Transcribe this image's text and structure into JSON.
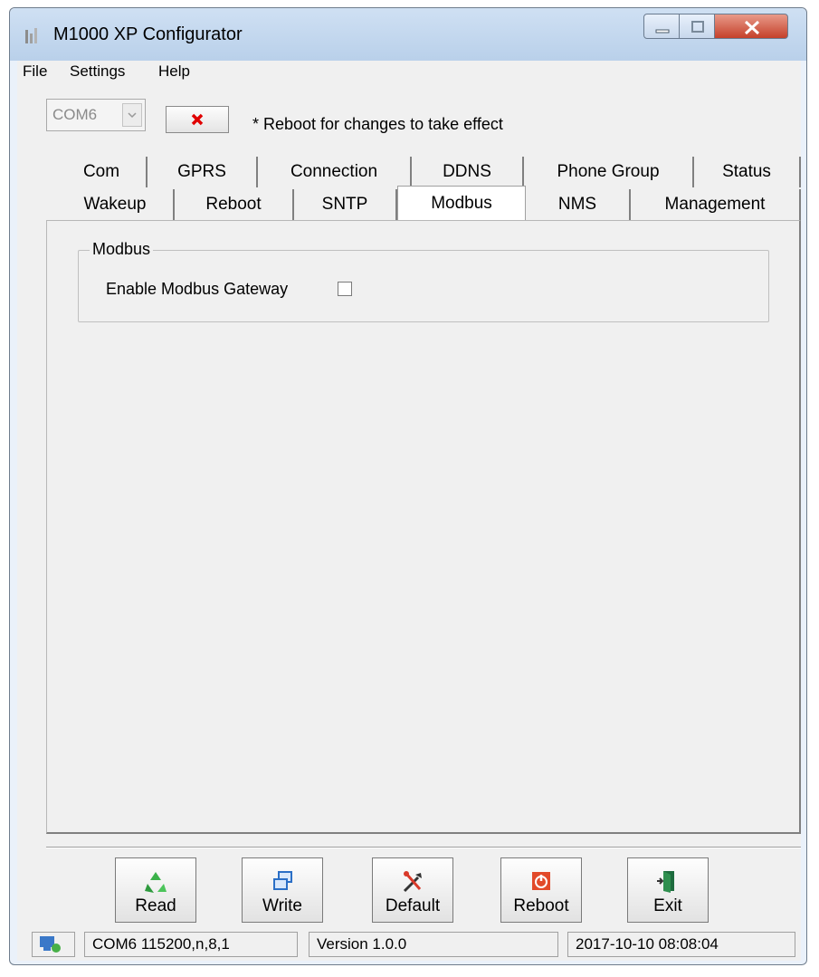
{
  "window": {
    "title": "M1000 XP Configurator"
  },
  "menu": [
    "File",
    "Settings",
    "Help"
  ],
  "toolbar": {
    "port_value": "COM6",
    "notice": "* Reboot for changes to take effect"
  },
  "tabs": {
    "row1": [
      "Com",
      "GPRS",
      "Connection",
      "DDNS",
      "Phone Group",
      "Status"
    ],
    "row2": [
      "Wakeup",
      "Reboot",
      "SNTP",
      "Modbus",
      "NMS",
      "Management"
    ],
    "active": "Modbus"
  },
  "modbus": {
    "group_title": "Modbus",
    "enable_label": "Enable Modbus Gateway",
    "enable_checked": false
  },
  "buttons": {
    "read": "Read",
    "write": "Write",
    "default": "Default",
    "reboot": "Reboot",
    "exit": "Exit"
  },
  "status": {
    "port_info": "COM6 115200,n,8,1",
    "version": "Version 1.0.0",
    "datetime": "2017-10-10 08:08:04"
  },
  "colors": {
    "close_button": "#c5402a",
    "disconnect_x": "#e00000",
    "reboot_icon": "#e24a2a"
  }
}
